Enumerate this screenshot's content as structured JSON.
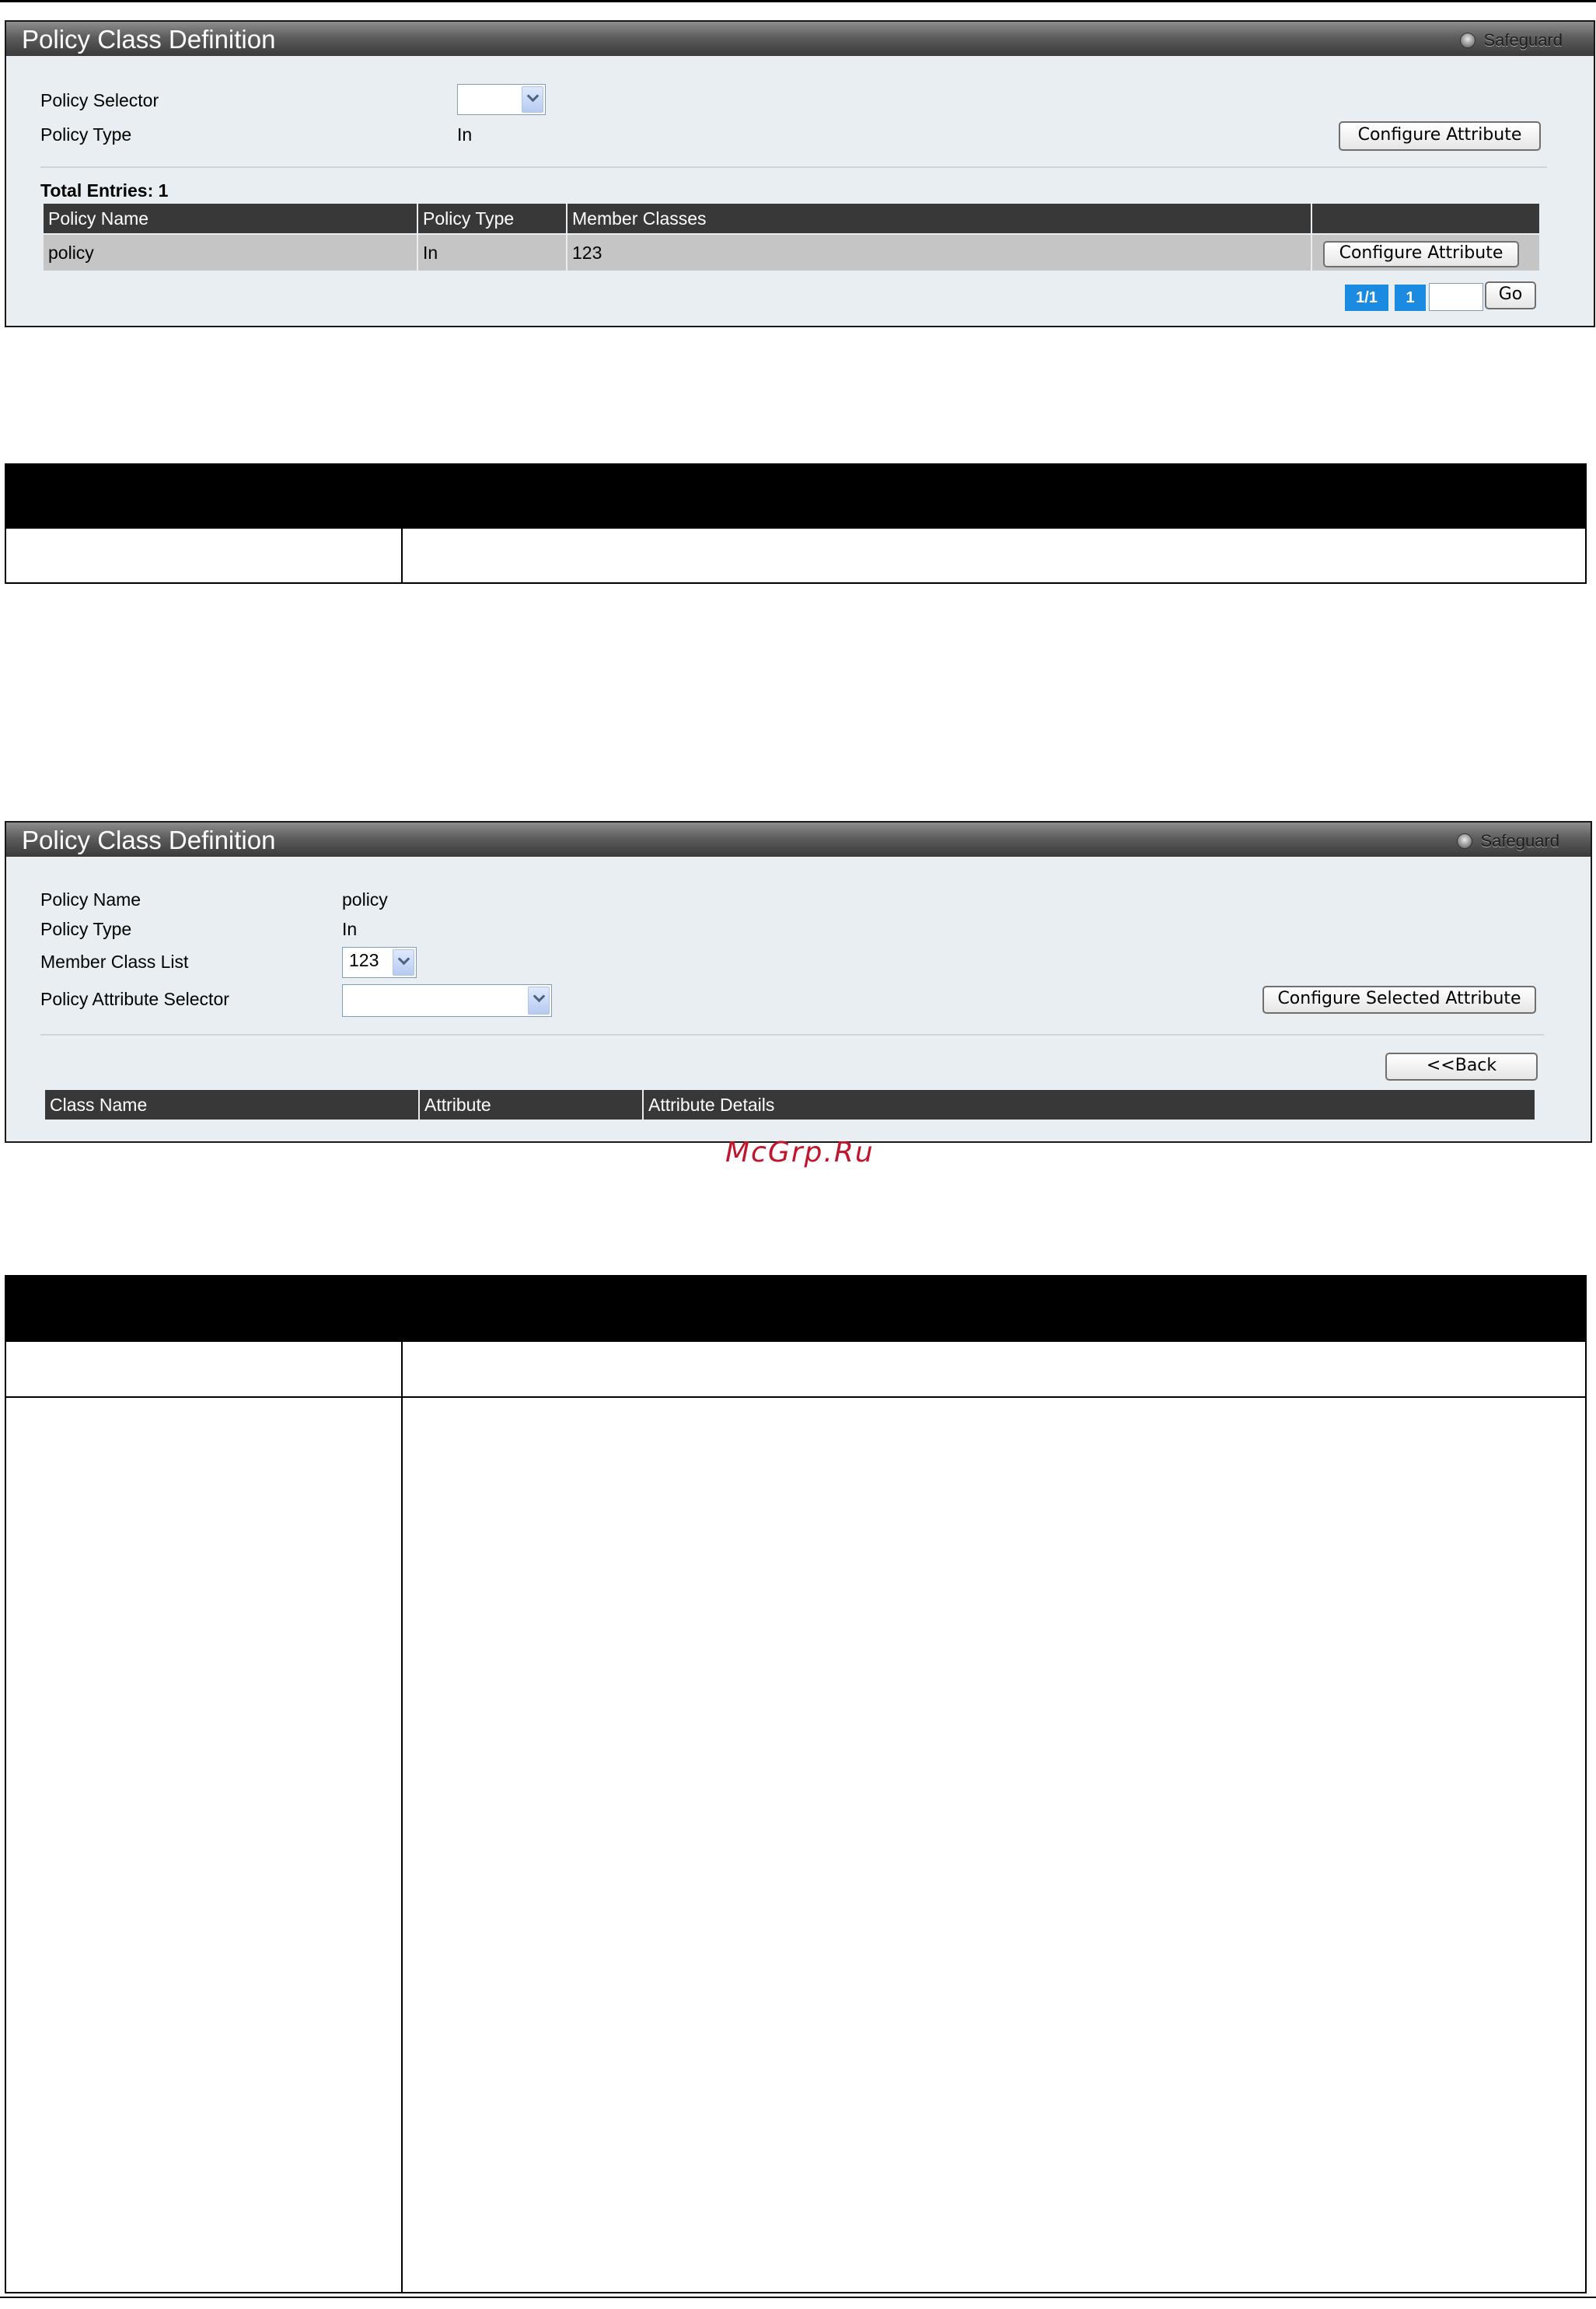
{
  "panel1": {
    "title": "Policy Class Definition",
    "safeguard": "Safeguard",
    "policy_selector_label": "Policy Selector",
    "policy_selector_value": "",
    "policy_type_label": "Policy Type",
    "policy_type_value": "In",
    "configure_button": "Configure Attribute",
    "total_entries": "Total Entries: 1",
    "table": {
      "headers": [
        "Policy Name",
        "Policy Type",
        "Member Classes",
        ""
      ],
      "rows": [
        {
          "policy_name": "policy",
          "policy_type": "In",
          "member_classes": "123",
          "action": "Configure Attribute"
        }
      ]
    },
    "pagination": {
      "page_info": "1/1",
      "current_page": "1",
      "go_input": "",
      "go_button": "Go"
    }
  },
  "panel2": {
    "title": "Policy Class Definition",
    "safeguard": "Safeguard",
    "policy_name_label": "Policy Name",
    "policy_name_value": "policy",
    "policy_type_label": "Policy Type",
    "policy_type_value": "In",
    "member_class_label": "Member Class List",
    "member_class_value": "123",
    "attr_selector_label": "Policy Attribute Selector",
    "attr_selector_value": "",
    "configure_selected_button": "Configure Selected Attribute",
    "back_button": "<<Back",
    "table": {
      "headers": [
        "Class Name",
        "Attribute",
        "Attribute Details"
      ]
    }
  },
  "watermark": "McGrp.Ru"
}
